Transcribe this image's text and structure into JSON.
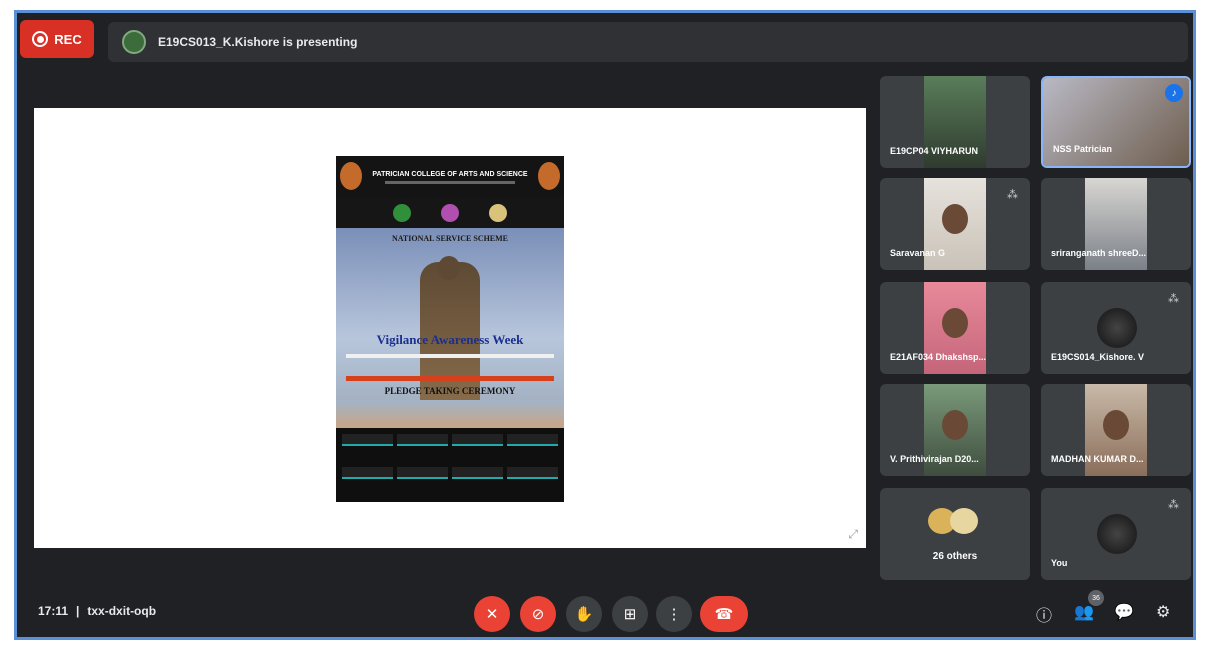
{
  "top_bar": {
    "rec_label": "REC",
    "presenting_text": "E19CS013_K.Kishore is presenting"
  },
  "shared_screen": {
    "poster_title": "Vigilance Awareness Week",
    "poster_subtitle": "PLEDGE TAKING CEREMONY",
    "poster_unit": "NATIONAL SERVICE SCHEME",
    "poster_college": "PATRICIAN COLLEGE OF ARTS AND SCIENCE"
  },
  "participants": [
    {
      "name": "E19CP04 VIYHARUN",
      "kind": "video",
      "state": "normal"
    },
    {
      "name": "NSS Patrician",
      "kind": "video",
      "state": "speaking"
    },
    {
      "name": "Saravanan G",
      "kind": "video",
      "state": "muted"
    },
    {
      "name": "sriranganath shreeD...",
      "kind": "video",
      "state": "normal"
    },
    {
      "name": "E21AF034 Dhakshsp...",
      "kind": "video",
      "state": "normal"
    },
    {
      "name": "E19CS014_Kishore. V",
      "kind": "avatar",
      "state": "muted"
    },
    {
      "name": "V. Prithivirajan D20...",
      "kind": "video",
      "state": "normal"
    },
    {
      "name": "MADHAN KUMAR D...",
      "kind": "video",
      "state": "normal"
    },
    {
      "name": "26 others",
      "kind": "others",
      "state": "normal"
    },
    {
      "name": "You",
      "kind": "avatar",
      "state": "muted"
    }
  ],
  "bottom_bar": {
    "time": "17:11",
    "separator": "|",
    "meeting_code": "txx-dxit-oqb",
    "people_badge": "36"
  },
  "colors": {
    "bar_bg": "#202124",
    "tile_bg": "#3c4043",
    "danger": "#ea4335",
    "accent": "#1a73e8",
    "frame_border": "#5b8fd6"
  }
}
